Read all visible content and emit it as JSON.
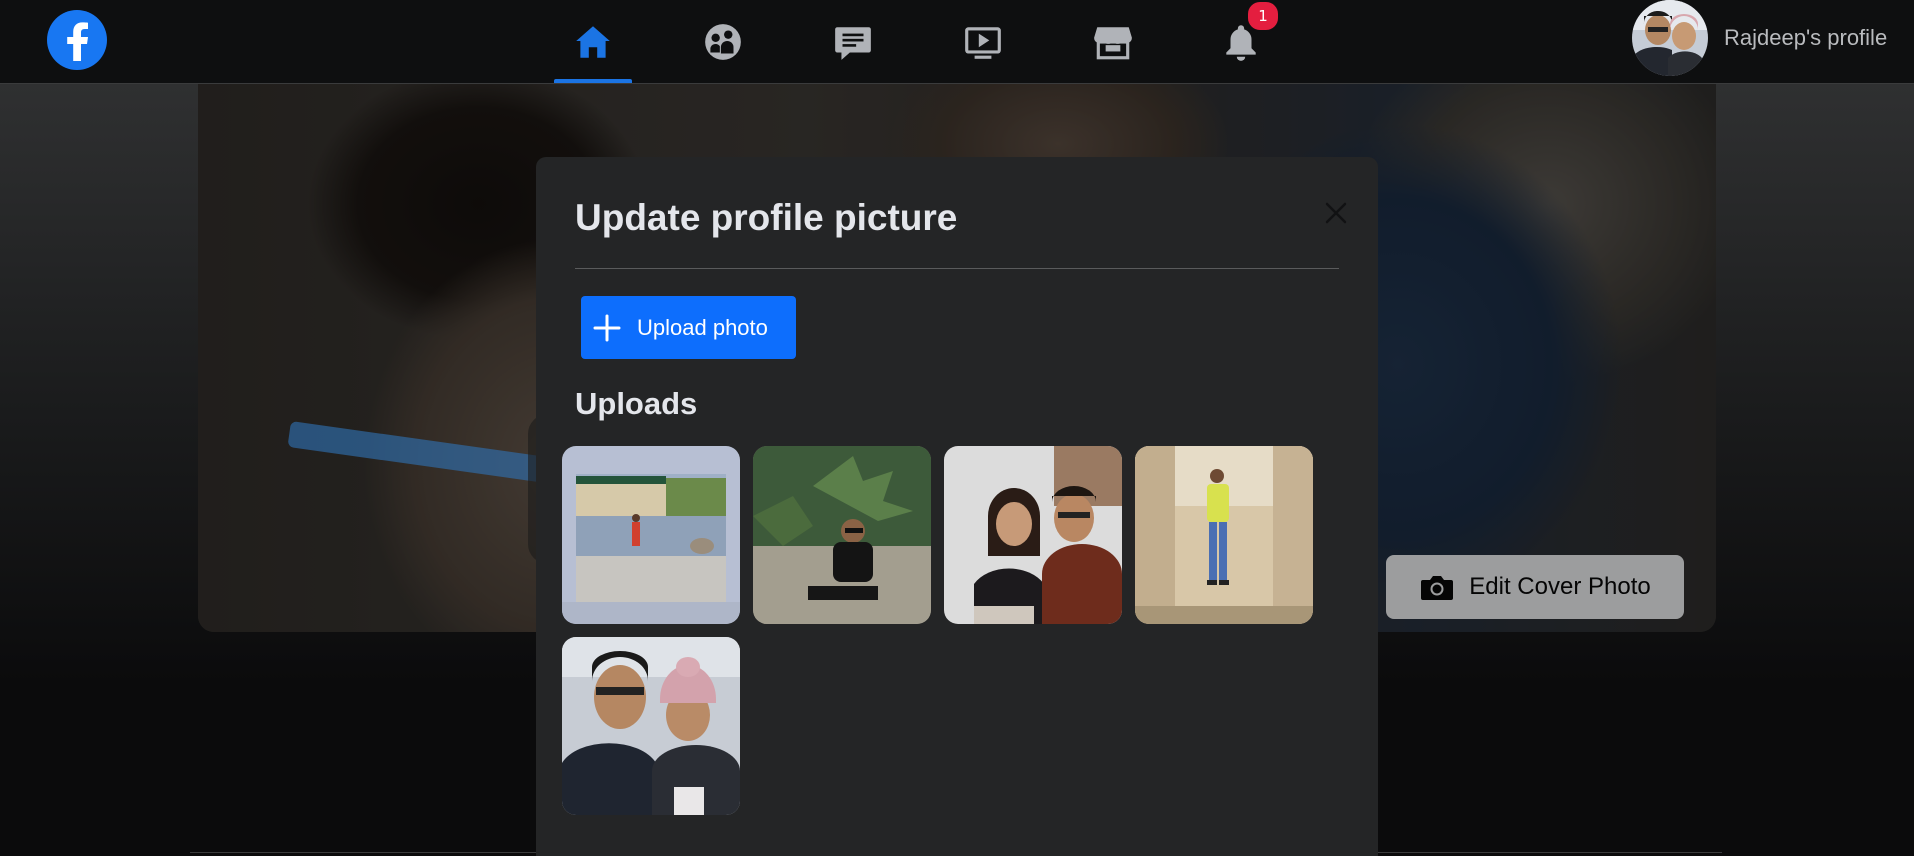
{
  "nav": {
    "logo_icon": "facebook-logo-icon",
    "items": [
      {
        "icon": "home-icon",
        "active": true
      },
      {
        "icon": "groups-icon",
        "active": false
      },
      {
        "icon": "messenger-icon",
        "active": false
      },
      {
        "icon": "watch-icon",
        "active": false
      },
      {
        "icon": "marketplace-icon",
        "active": false
      },
      {
        "icon": "notifications-icon",
        "active": false,
        "badge": "1"
      }
    ],
    "profile_label": "Rajdeep's profile",
    "accent": "#1b74e4",
    "badge_color": "#e41e3f"
  },
  "cover": {
    "edit_label": "Edit Cover Photo",
    "edit_icon": "camera-icon"
  },
  "modal": {
    "title": "Update profile picture",
    "close_icon": "close-icon",
    "upload_label": "Upload photo",
    "upload_icon": "plus-icon",
    "upload_color": "#0d6efd",
    "uploads_heading": "Uploads",
    "photos": [
      {
        "description_icon": "photo-thumbnail-1"
      },
      {
        "description_icon": "photo-thumbnail-2"
      },
      {
        "description_icon": "photo-thumbnail-3"
      },
      {
        "description_icon": "photo-thumbnail-4"
      },
      {
        "description_icon": "photo-thumbnail-5"
      }
    ]
  }
}
